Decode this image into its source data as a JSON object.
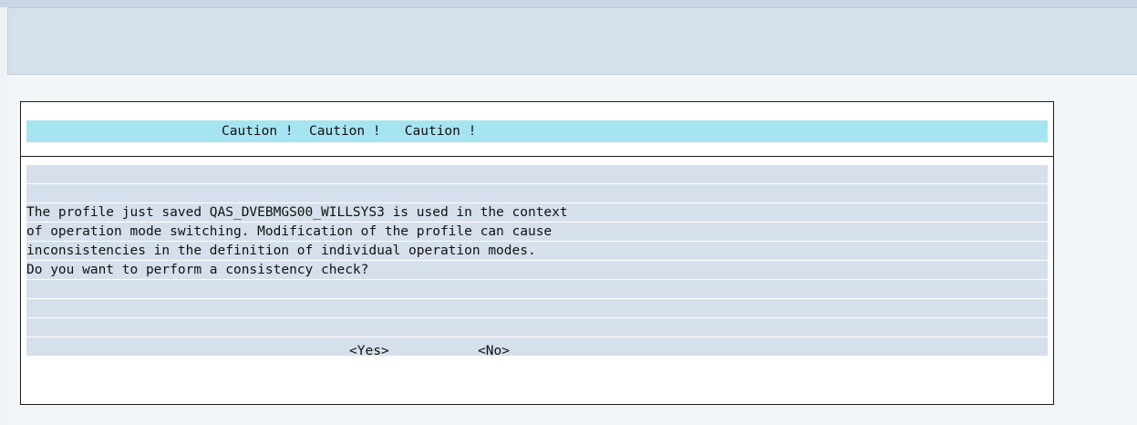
{
  "dialog": {
    "title": "Caution !  Caution !   Caution !",
    "message_lines": [
      "The profile just saved QAS_DVEBMGS00_WILLSYS3 is used in the context",
      "of operation mode switching. Modification of the profile can cause",
      "inconsistencies in the definition of individual operation modes.",
      "Do you want to perform a consistency check?"
    ],
    "yes_label": "<Yes>",
    "no_label": "<No>"
  },
  "colors": {
    "title_bar": "#a7e4f2",
    "row_background": "#d6e0ec",
    "toolbar_band": "#d5e0ea"
  }
}
